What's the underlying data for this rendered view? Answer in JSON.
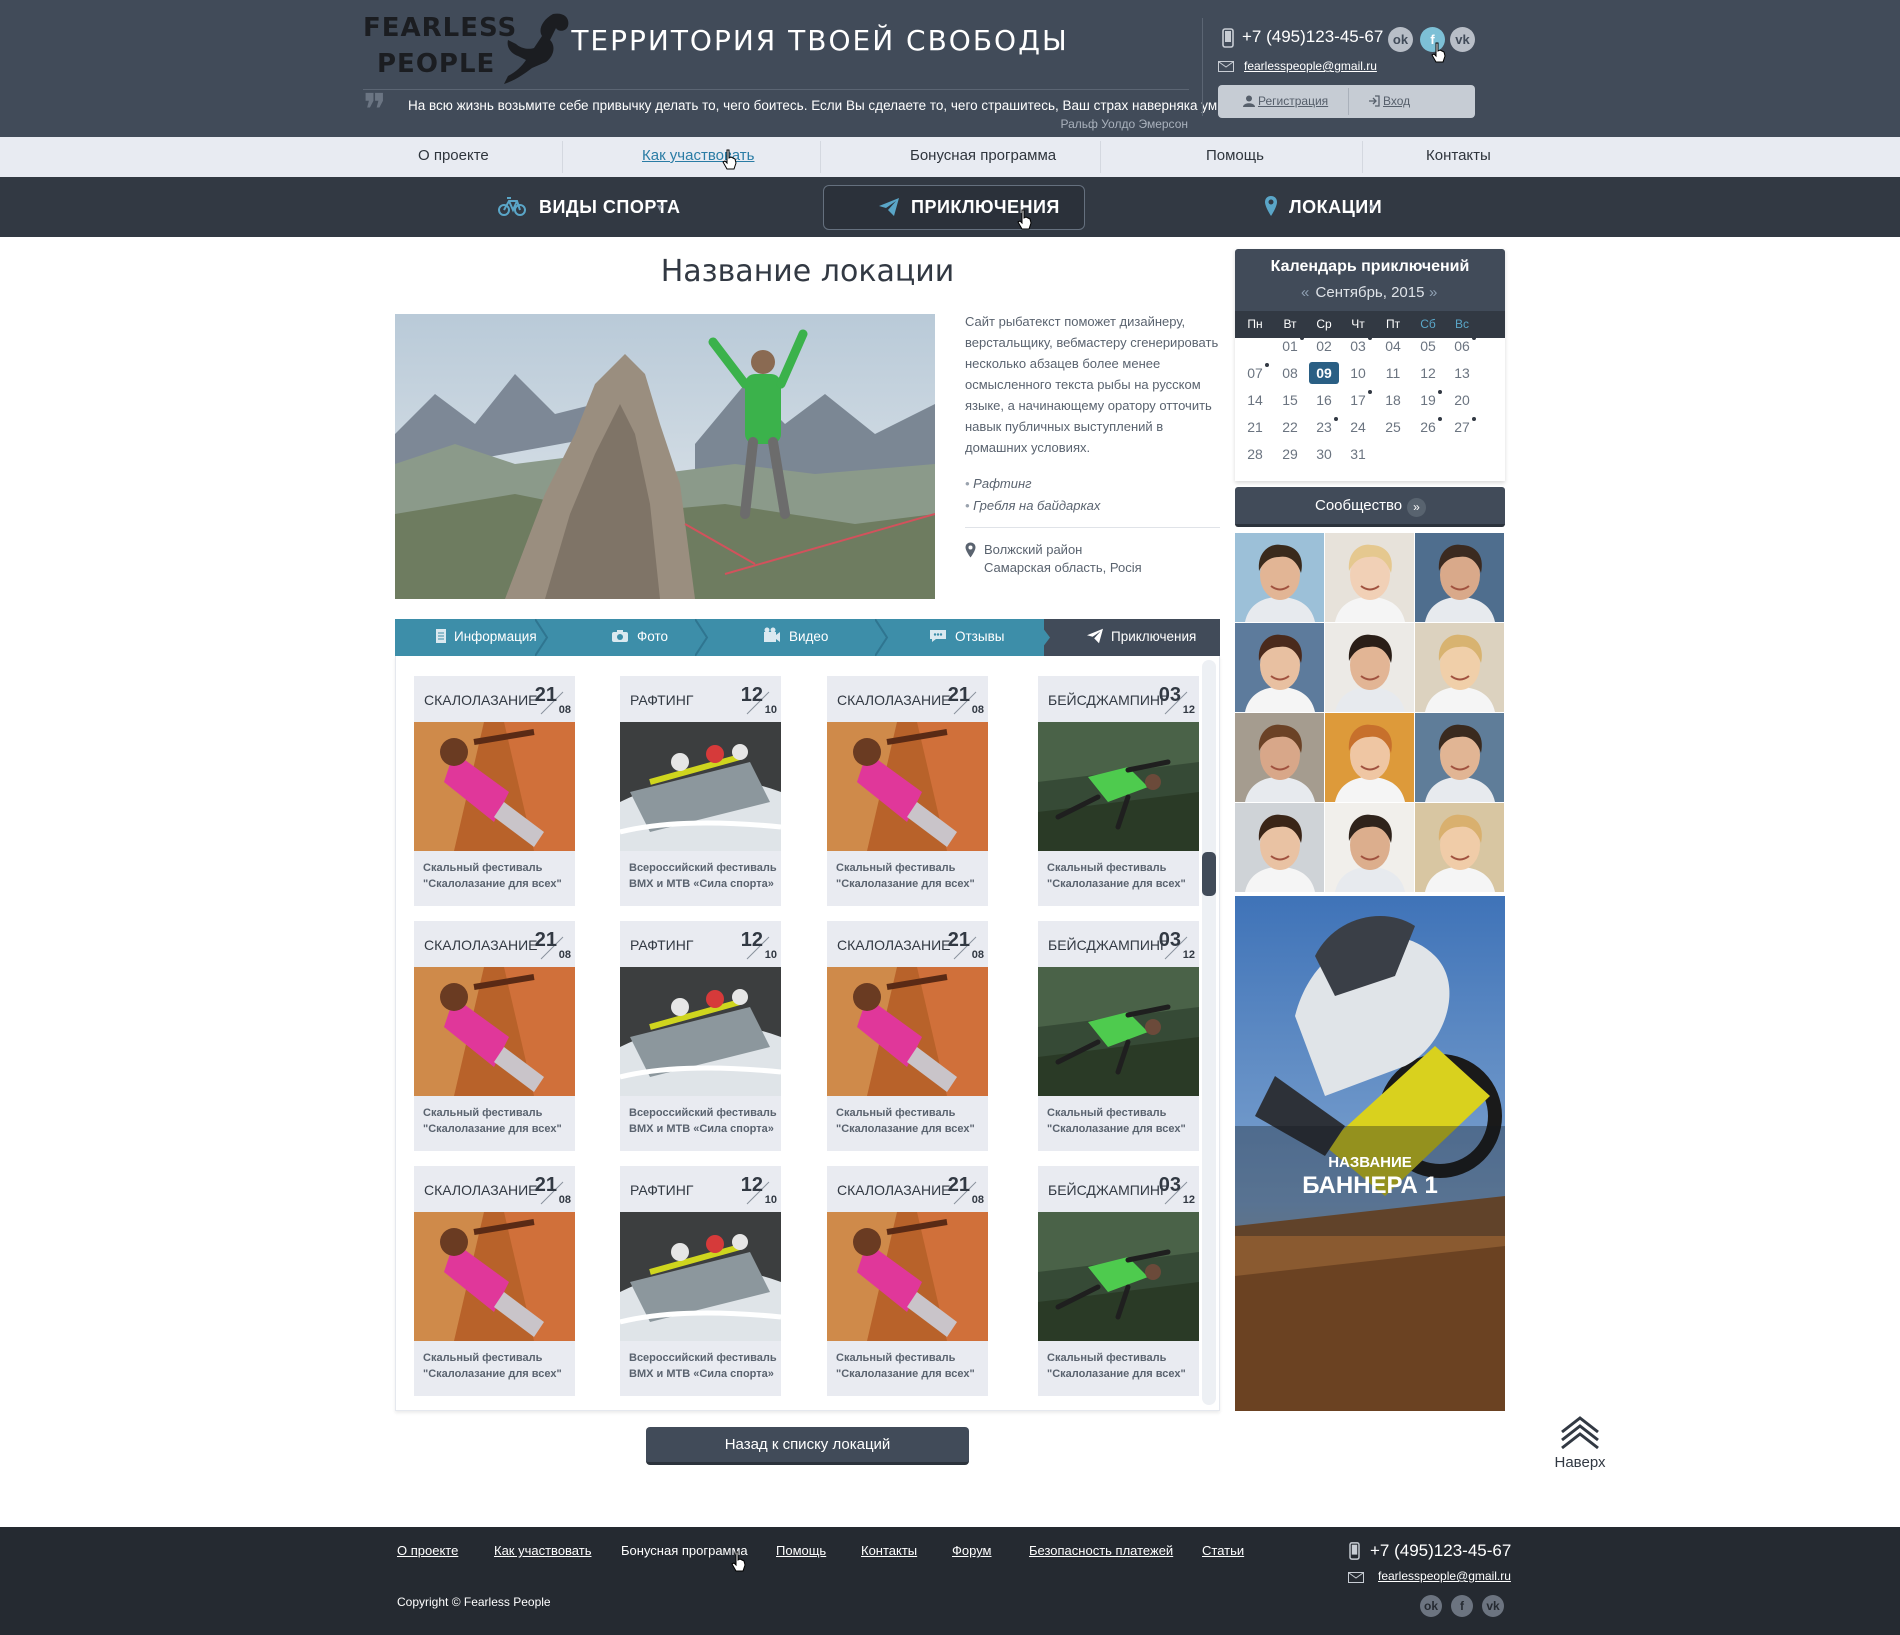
{
  "header": {
    "logo_line1": "FEARLESS",
    "logo_line2": "PEOPLE",
    "tagline": "ТЕРРИТОРИЯ ТВОЕЙ СВОБОДЫ",
    "quote": "На всю жизнь возьмите себе привычку делать то, чего боитесь. Если Вы сделаете то, чего страшитесь, Ваш страх наверняка умрёт.",
    "quote_author": "Ральф Уолдо Эмерсон",
    "phone": "+7 (495)123-45-67",
    "email": "fearlesspeople@gmail.ru",
    "social": [
      {
        "icon": "odnoklassniki-icon",
        "glyph": "ok"
      },
      {
        "icon": "facebook-icon",
        "glyph": "f"
      },
      {
        "icon": "vk-icon",
        "glyph": "vk"
      }
    ],
    "register": "Регистрация",
    "login": "Вход"
  },
  "top_nav": [
    {
      "label": "О проекте",
      "active": false
    },
    {
      "label": "Как участвовать",
      "active": true
    },
    {
      "label": "Бонусная программа",
      "active": false
    },
    {
      "label": "Помощь",
      "active": false
    },
    {
      "label": "Контакты",
      "active": false
    }
  ],
  "main_nav": [
    {
      "label": "ВИДЫ СПОРТА",
      "icon": "bicycle-icon"
    },
    {
      "label": "ПРИКЛЮЧЕНИЯ",
      "icon": "paper-plane-icon",
      "active": true
    },
    {
      "label": "ЛОКАЦИИ",
      "icon": "map-pin-icon"
    }
  ],
  "location": {
    "title": "Название локации",
    "description": "Сайт рыбатекст поможет дизайнеру, верстальщику, вебмастеру сгенерировать несколько абзацев более менее осмысленного текста рыбы на русском языке, а начинающему оратору отточить навык публичных выступлений в домашних условиях.",
    "tags": [
      "Рафтинг",
      "Гребля на байдарках"
    ],
    "address_line1": "Волжский район",
    "address_line2": "Самарская область, Росія"
  },
  "tabs": [
    {
      "label": "Информация",
      "icon": "document-icon"
    },
    {
      "label": "Фото",
      "icon": "camera-icon"
    },
    {
      "label": "Видео",
      "icon": "video-icon"
    },
    {
      "label": "Отзывы",
      "icon": "comments-icon"
    },
    {
      "label": "Приключения",
      "icon": "paper-plane-icon",
      "active": true
    }
  ],
  "cards": [
    {
      "category": "СКАЛОЛАЗАНИЕ",
      "day": "21",
      "month": "08",
      "title1": "Скальный фестиваль",
      "title2": "\"Скалолазание для всех\"",
      "image": "climbing"
    },
    {
      "category": "РАФТИНГ",
      "day": "12",
      "month": "10",
      "title1": "Всероссийский фестиваль",
      "title2": "BMX и MTB «Сила спорта»",
      "image": "rafting"
    },
    {
      "category": "СКАЛОЛАЗАНИЕ",
      "day": "21",
      "month": "08",
      "title1": "Скальный фестиваль",
      "title2": "\"Скалолазание для всех\"",
      "image": "climbing"
    },
    {
      "category": "БЕЙСДЖАМПИНГ",
      "day": "03",
      "month": "12",
      "title1": "Скальный фестиваль",
      "title2": "\"Скалолазание для всех\"",
      "image": "basejump"
    }
  ],
  "back_button": "Назад к списку локаций",
  "calendar": {
    "title": "Календарь приключений",
    "month": "Сентябрь, 2015",
    "prev": "«",
    "next": "»",
    "day_names": [
      "Пн",
      "Вт",
      "Ср",
      "Чт",
      "Пт",
      "Сб",
      "Вс"
    ],
    "weeks": [
      [
        "",
        "01",
        "02",
        "03",
        "04",
        "05",
        "06"
      ],
      [
        "07",
        "08",
        "09",
        "10",
        "11",
        "12",
        "13"
      ],
      [
        "14",
        "15",
        "16",
        "17",
        "18",
        "19",
        "20"
      ],
      [
        "21",
        "22",
        "23",
        "24",
        "25",
        "26",
        "27"
      ],
      [
        "28",
        "29",
        "30",
        "31",
        "",
        "",
        ""
      ]
    ],
    "selected": "09",
    "event_days": [
      "01",
      "03",
      "06",
      "07",
      "17",
      "19",
      "23",
      "26",
      "27"
    ]
  },
  "community": {
    "label": "Сообщество",
    "arrow": "»"
  },
  "banner": {
    "subtitle": "НАЗВАНИЕ",
    "title": "БАННЕРА 1"
  },
  "to_top": "Наверх",
  "footer": {
    "links": [
      "О проекте",
      "Как участвовать",
      "Бонусная программа",
      "Помощь",
      "Контакты",
      "Форум",
      "Безопасность платежей",
      "Статьи"
    ],
    "copyright": "Copyright © Fearless People",
    "phone": "+7 (495)123-45-67",
    "email": "fearlesspeople@gmail.ru"
  },
  "colors": {
    "header_bg": "#414b59",
    "nav_dark": "#323943",
    "tab_bg": "#3d8ea9",
    "accent": "#2a7ca5",
    "footer_bg": "#252a31"
  }
}
